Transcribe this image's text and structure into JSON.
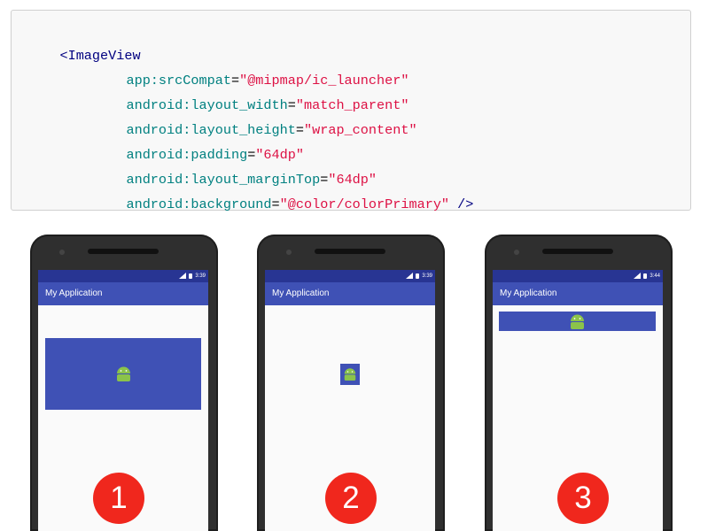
{
  "code": {
    "open_tag": "<ImageView",
    "attributes": [
      {
        "name": "app:srcCompat",
        "value": "\"@mipmap/ic_launcher\"",
        "suffix": ""
      },
      {
        "name": "android:layout_width",
        "value": "\"match_parent\"",
        "suffix": ""
      },
      {
        "name": "android:layout_height",
        "value": "\"wrap_content\"",
        "suffix": ""
      },
      {
        "name": "android:padding",
        "value": "\"64dp\"",
        "suffix": ""
      },
      {
        "name": "android:layout_marginTop",
        "value": "\"64dp\"",
        "suffix": ""
      },
      {
        "name": "android:background",
        "value": "\"@color/colorPrimary\"",
        "suffix": " />"
      }
    ]
  },
  "phones": [
    {
      "time": "3:39",
      "app_title": "My Application",
      "badge": "1"
    },
    {
      "time": "3:39",
      "app_title": "My Application",
      "badge": "2"
    },
    {
      "time": "3:44",
      "app_title": "My Application",
      "badge": "3"
    }
  ],
  "colors": {
    "primary": "#3f51b5",
    "primary_dark": "#283593",
    "android_green": "#8bc34a",
    "badge_red": "#f0271d"
  },
  "icons": [
    "camera-icon",
    "wifi-icon",
    "battery-icon",
    "android-icon"
  ]
}
